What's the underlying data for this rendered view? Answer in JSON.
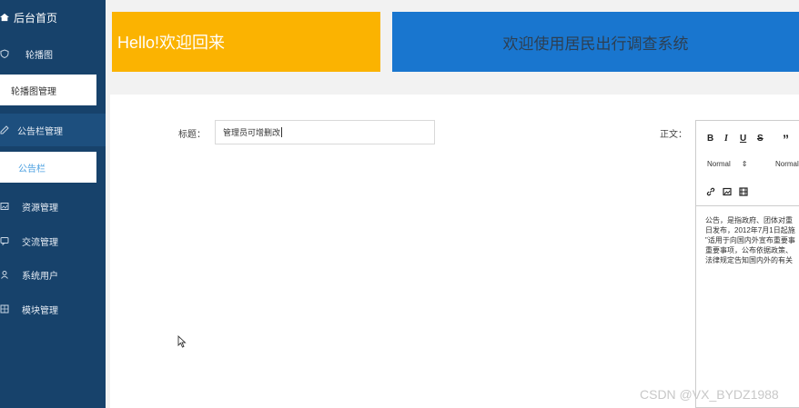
{
  "sidebar": {
    "title": "后台首页",
    "items": [
      {
        "label": "轮播图",
        "icon": "shield-icon"
      },
      {
        "label": "轮播图管理"
      },
      {
        "label": "公告栏管理",
        "icon": "edit-icon"
      },
      {
        "label": "公告栏"
      },
      {
        "label": "资源管理",
        "icon": "image-icon"
      },
      {
        "label": "交流管理",
        "icon": "chat-icon"
      },
      {
        "label": "系统用户",
        "icon": "user-icon"
      },
      {
        "label": "模块管理",
        "icon": "grid-icon"
      }
    ]
  },
  "banners": {
    "left": "Hello!欢迎回来",
    "right": "欢迎使用居民出行调查系统"
  },
  "form": {
    "title_label": "标题：",
    "title_value": "管理员可增删改",
    "body_label": "正文："
  },
  "editor": {
    "toolbar": {
      "bold": "B",
      "italic": "I",
      "underline": "U",
      "strike": "S",
      "quote": "”",
      "select1": "Normal",
      "select2": "Normal"
    },
    "content": "公告，是指政府、团体对重\n日发布，2012年7月1日起施\n\"适用于向国内外宣布重要事\n重要事项，公布依据政策、\n法律规定告知国内外的有关"
  },
  "watermark": "CSDN @VX_BYDZ1988"
}
